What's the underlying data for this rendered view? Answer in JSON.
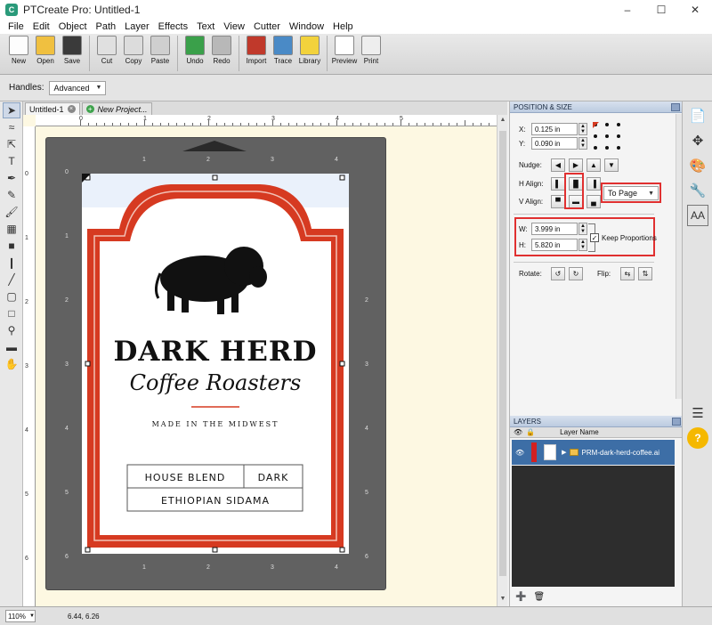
{
  "window": {
    "title": "PTCreate Pro: Untitled-1",
    "app_icon": "ptcreate-app-icon"
  },
  "menu": [
    "File",
    "Edit",
    "Object",
    "Path",
    "Layer",
    "Effects",
    "Text",
    "View",
    "Cutter",
    "Window",
    "Help"
  ],
  "toolbar": {
    "buttons": [
      {
        "label": "New",
        "icon": "new-icon"
      },
      {
        "label": "Open",
        "icon": "open-icon"
      },
      {
        "label": "Save",
        "icon": "save-icon"
      },
      {
        "label": "Cut",
        "icon": "cut-icon"
      },
      {
        "label": "Copy",
        "icon": "copy-icon"
      },
      {
        "label": "Paste",
        "icon": "paste-icon"
      },
      {
        "label": "Undo",
        "icon": "undo-icon"
      },
      {
        "label": "Redo",
        "icon": "redo-icon"
      },
      {
        "label": "Import",
        "icon": "import-svg-icon"
      },
      {
        "label": "Trace",
        "icon": "trace-icon"
      },
      {
        "label": "Library",
        "icon": "library-icon"
      },
      {
        "label": "Preview",
        "icon": "preview-icon"
      },
      {
        "label": "Print",
        "icon": "print-icon"
      }
    ]
  },
  "options": {
    "handles_label": "Handles:",
    "handles_value": "Advanced"
  },
  "tabs": [
    {
      "label": "Untitled-1"
    },
    {
      "label": "New Project..."
    }
  ],
  "rulers": {
    "top": [
      "0",
      "1",
      "2",
      "3",
      "4",
      "5"
    ],
    "left": [
      "0",
      "1",
      "2",
      "3",
      "4",
      "5",
      "6"
    ]
  },
  "mat_ticks": {
    "top": [
      "1",
      "2",
      "3",
      "4"
    ],
    "bottom": [
      "1",
      "2",
      "3",
      "4"
    ],
    "left": [
      "0",
      "1",
      "2",
      "3",
      "4",
      "5",
      "6"
    ],
    "right": [
      "2",
      "3",
      "4",
      "5",
      "6"
    ]
  },
  "label": {
    "brand": "DARK HERD",
    "script": "Coffee Roasters",
    "tagline": "Made in the Midwest",
    "cell_blend": "HOUSE BLEND",
    "cell_roast": "DARK",
    "cell_origin": "ETHIOPIAN SIDAMA"
  },
  "position_size": {
    "header": "POSITION & SIZE",
    "x_label": "X:",
    "x_value": "0.125 in",
    "y_label": "Y:",
    "y_value": "0.090 in",
    "nudge_label": "Nudge:",
    "halign_label": "H Align:",
    "valign_label": "V Align:",
    "align_to": "To Page",
    "w_label": "W:",
    "w_value": "3.999 in",
    "h_label": "H:",
    "h_value": "5.820 in",
    "keep_proportions": "Keep Proportions",
    "keep_proportions_checked": true,
    "rotate_label": "Rotate:",
    "flip_label": "Flip:"
  },
  "layers": {
    "header": "LAYERS",
    "column": "Layer Name",
    "item": "PRM-dark-herd-coffee.ai"
  },
  "status": {
    "zoom": "110%",
    "coords": "6.44, 6.26"
  },
  "colors": {
    "accent_red": "#d63a21",
    "panel_blue": "#3d6ea6",
    "mat_gray": "#616161"
  }
}
